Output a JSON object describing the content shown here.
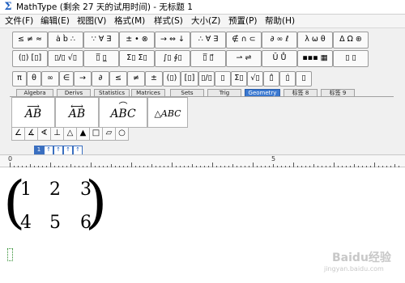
{
  "window": {
    "title": "MathType (剩余 27 天的试用时间) - 无标题 1",
    "app_icon": "sigma-app-icon"
  },
  "menu": [
    {
      "label": "文件(F)"
    },
    {
      "label": "编辑(E)"
    },
    {
      "label": "视图(V)"
    },
    {
      "label": "格式(M)"
    },
    {
      "label": "样式(S)"
    },
    {
      "label": "大小(Z)"
    },
    {
      "label": "预置(P)"
    },
    {
      "label": "帮助(H)"
    }
  ],
  "palettes_row1": [
    "≤ ≠ ≈",
    "ȧ b̀ ∴",
    "∵ ∀ ∃",
    "± • ⊗",
    "→ ⇔ ↓",
    "∴ ∀ ∃",
    "∉ ∩ ⊂",
    "∂ ∞ ℓ",
    "λ ω θ",
    "Δ Ω ⊛"
  ],
  "palettes_row2": [
    "(▯) [▯]",
    "▯/▯ √▯",
    "▯̅ ▯̲",
    "Σ▯ Σ▯",
    "∫▯ ∮▯",
    "▯̅ ▯⃗",
    "⇀ ⇌",
    "Ū Ů",
    "▪▪▪ ▦",
    "▯ ▯"
  ],
  "palettes_row3": [
    "π",
    "θ",
    "∞",
    "∈",
    "→",
    "∂",
    "≤",
    "≠",
    "±",
    "(▯)",
    "[▯]",
    "▯/▯",
    "▯",
    "Σ▯",
    "√▯",
    "▯̂",
    "▯̇",
    "▯"
  ],
  "tabs": [
    {
      "label": "Algebra",
      "active": false
    },
    {
      "label": "Derivs",
      "active": false
    },
    {
      "label": "Statistics",
      "active": false
    },
    {
      "label": "Matrices",
      "active": false
    },
    {
      "label": "Sets",
      "active": false
    },
    {
      "label": "Trig",
      "active": false
    },
    {
      "label": "Geometry",
      "active": true
    },
    {
      "label": "标签 8",
      "active": false
    },
    {
      "label": "标签 9",
      "active": false
    }
  ],
  "templates": [
    {
      "text": "AB",
      "over": "⟶"
    },
    {
      "text": "AB",
      "over": "⟷"
    },
    {
      "text": "ABC",
      "over": "⌒"
    },
    {
      "text": "△ABC",
      "over": ""
    }
  ],
  "shapes": [
    "∠",
    "∡",
    "∢",
    "⊥",
    "△",
    "▲",
    "□",
    "▱",
    "○"
  ],
  "ruler": {
    "buttons": [
      "1",
      "↑",
      "↑",
      "↑",
      "↑"
    ],
    "label_0": "0",
    "label_5": "5"
  },
  "matrix": {
    "rows": [
      [
        "1",
        "2",
        "3"
      ],
      [
        "4",
        "5",
        "6"
      ]
    ],
    "open_paren": "(",
    "close_paren": ")"
  },
  "watermark": {
    "main": "Baidu经验",
    "sub": "jingyan.baidu.com"
  }
}
